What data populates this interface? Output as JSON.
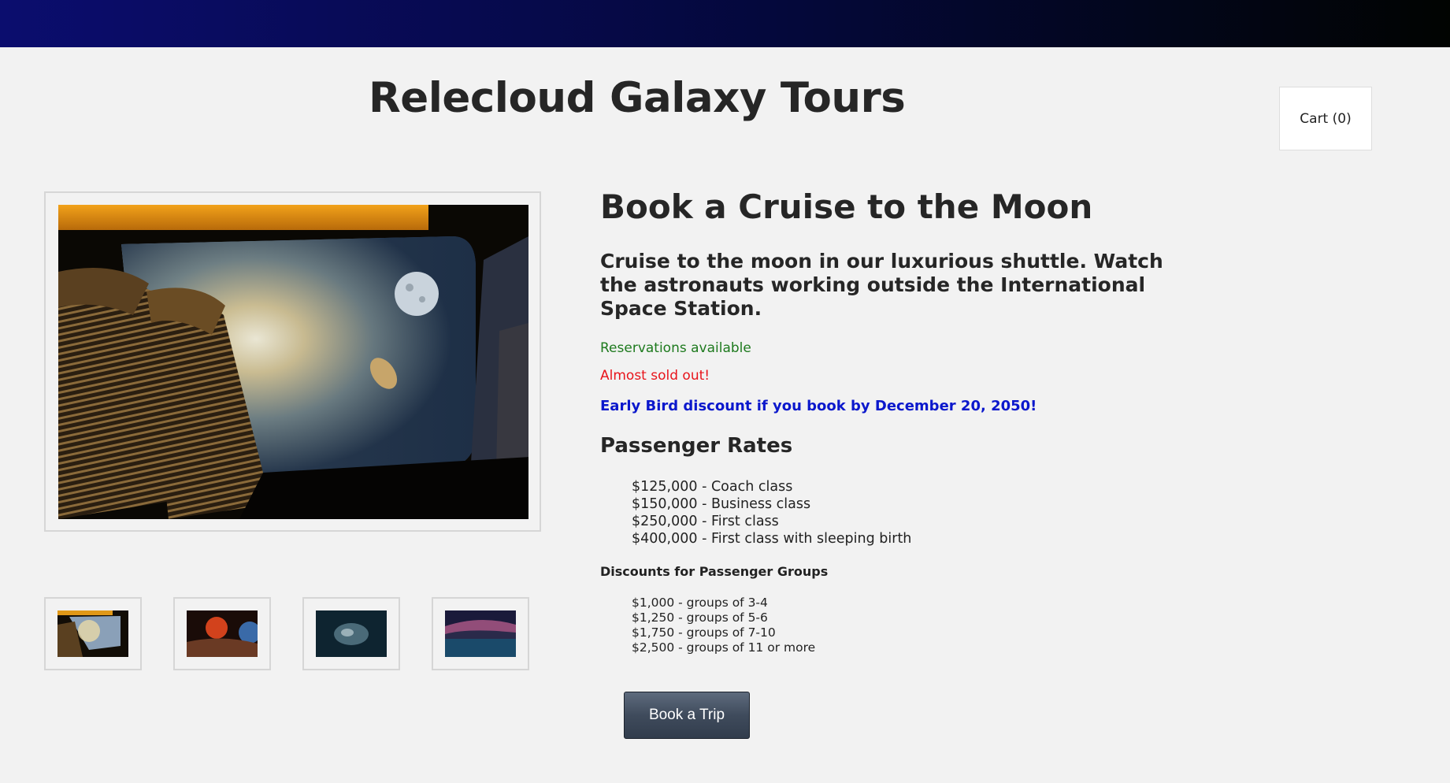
{
  "header": {
    "site_title": "Relecloud Galaxy Tours",
    "cart_label": "Cart (0)"
  },
  "gallery": {
    "main_image": "moon-shuttle-cabin-image",
    "thumbnails": [
      "moon-shuttle-cabin-thumb",
      "red-planet-surface-thumb",
      "asteroid-ship-thumb",
      "alien-lake-nebula-thumb"
    ]
  },
  "tour": {
    "title": "Book a Cruise to the Moon",
    "description": "Cruise to the moon in our luxurious shuttle. Watch the astronauts working outside the International Space Station.",
    "status_available": "Reservations available",
    "status_sold_out": "Almost sold out!",
    "early_bird": "Early Bird discount if you book by December 20, 2050!",
    "rates_heading": "Passenger Rates",
    "rates": [
      "$125,000 - Coach class",
      "$150,000 - Business class",
      "$250,000 - First class",
      "$400,000 - First class with sleeping birth"
    ],
    "discounts_heading": "Discounts for Passenger Groups",
    "discounts": [
      "$1,000 - groups of 3-4",
      "$1,250 - groups of 5-6",
      "$1,750 - groups of 7-10",
      "$2,500 - groups of 11 or more"
    ],
    "book_button": "Book a Trip"
  },
  "colors": {
    "available": "#1e7a1e",
    "sold_out": "#e8141b",
    "early_bird": "#0b18cc",
    "button": "#3f4b5c"
  }
}
